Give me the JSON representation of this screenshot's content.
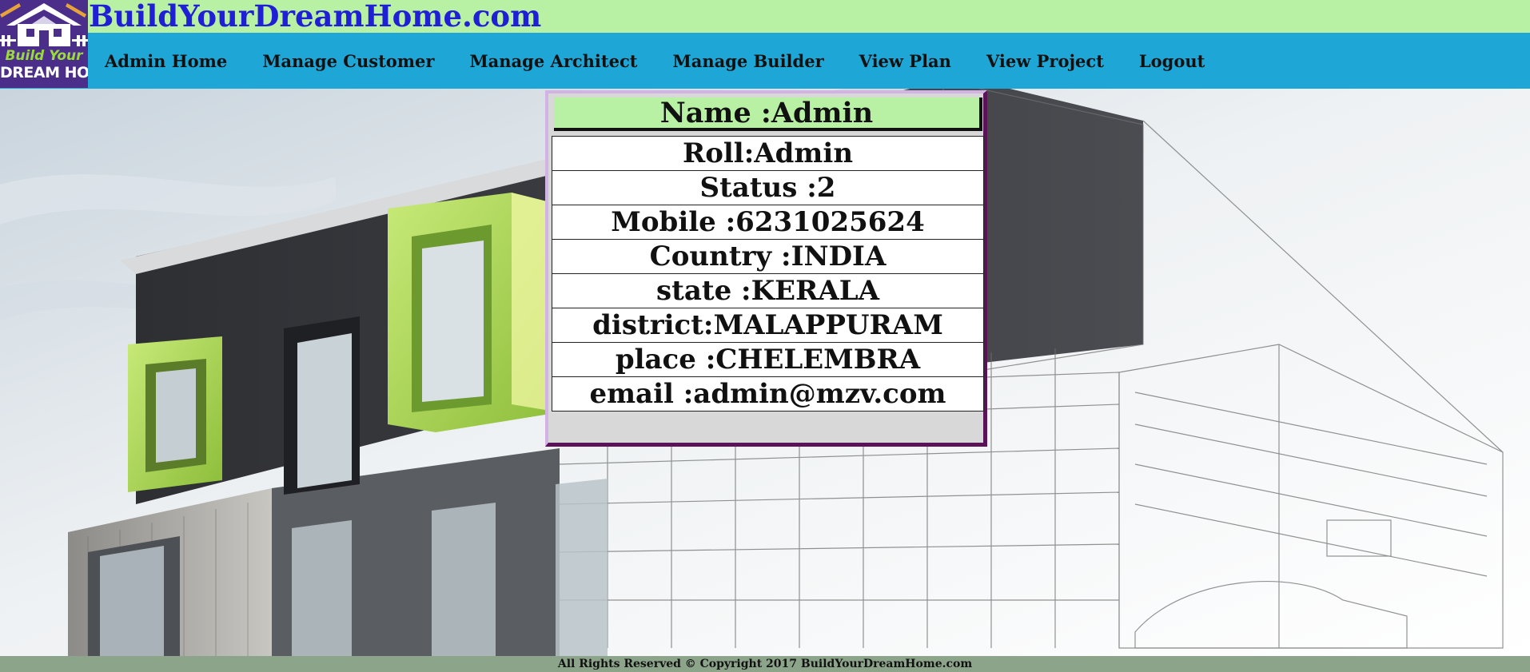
{
  "site": {
    "title": "BuildYourDreamHome.com",
    "logo_line1": "Build Your",
    "logo_line2": "DREAM HOME"
  },
  "nav": {
    "items": [
      "Admin Home",
      "Manage Customer",
      "Manage Architect",
      "Manage Builder",
      "View Plan",
      "View Project",
      "Logout"
    ]
  },
  "profile": {
    "name": "Name :Admin",
    "rows": [
      "Roll:Admin",
      "Status :2",
      "Mobile :6231025624",
      "Country :INDIA",
      "state :KERALA",
      "district:MALAPPURAM",
      "place :CHELEMBRA",
      "email :admin@mzv.com"
    ]
  },
  "footer": {
    "text": "All Rights Reserved © Copyright 2017 BuildYourDreamHome.com"
  },
  "colors": {
    "header_band": "#b8f0a4",
    "nav_band": "#1ea7d6",
    "title_text": "#1f1fd6",
    "footer_band": "#8ca58a",
    "card_border_dark": "#5a1358"
  }
}
